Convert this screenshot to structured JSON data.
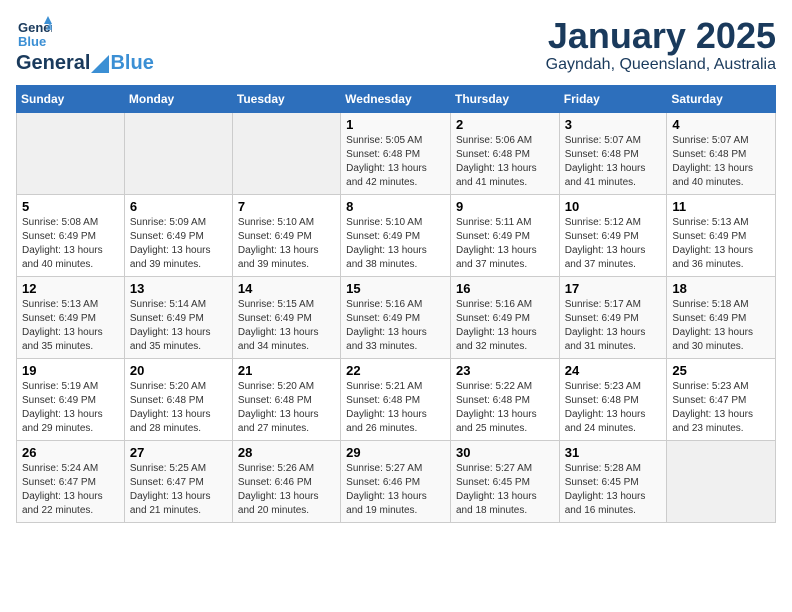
{
  "header": {
    "logo_general": "General",
    "logo_blue": "Blue",
    "title": "January 2025",
    "subtitle": "Gayndah, Queensland, Australia"
  },
  "weekdays": [
    "Sunday",
    "Monday",
    "Tuesday",
    "Wednesday",
    "Thursday",
    "Friday",
    "Saturday"
  ],
  "weeks": [
    [
      {
        "day": "",
        "info": ""
      },
      {
        "day": "",
        "info": ""
      },
      {
        "day": "",
        "info": ""
      },
      {
        "day": "1",
        "info": "Sunrise: 5:05 AM\nSunset: 6:48 PM\nDaylight: 13 hours\nand 42 minutes."
      },
      {
        "day": "2",
        "info": "Sunrise: 5:06 AM\nSunset: 6:48 PM\nDaylight: 13 hours\nand 41 minutes."
      },
      {
        "day": "3",
        "info": "Sunrise: 5:07 AM\nSunset: 6:48 PM\nDaylight: 13 hours\nand 41 minutes."
      },
      {
        "day": "4",
        "info": "Sunrise: 5:07 AM\nSunset: 6:48 PM\nDaylight: 13 hours\nand 40 minutes."
      }
    ],
    [
      {
        "day": "5",
        "info": "Sunrise: 5:08 AM\nSunset: 6:49 PM\nDaylight: 13 hours\nand 40 minutes."
      },
      {
        "day": "6",
        "info": "Sunrise: 5:09 AM\nSunset: 6:49 PM\nDaylight: 13 hours\nand 39 minutes."
      },
      {
        "day": "7",
        "info": "Sunrise: 5:10 AM\nSunset: 6:49 PM\nDaylight: 13 hours\nand 39 minutes."
      },
      {
        "day": "8",
        "info": "Sunrise: 5:10 AM\nSunset: 6:49 PM\nDaylight: 13 hours\nand 38 minutes."
      },
      {
        "day": "9",
        "info": "Sunrise: 5:11 AM\nSunset: 6:49 PM\nDaylight: 13 hours\nand 37 minutes."
      },
      {
        "day": "10",
        "info": "Sunrise: 5:12 AM\nSunset: 6:49 PM\nDaylight: 13 hours\nand 37 minutes."
      },
      {
        "day": "11",
        "info": "Sunrise: 5:13 AM\nSunset: 6:49 PM\nDaylight: 13 hours\nand 36 minutes."
      }
    ],
    [
      {
        "day": "12",
        "info": "Sunrise: 5:13 AM\nSunset: 6:49 PM\nDaylight: 13 hours\nand 35 minutes."
      },
      {
        "day": "13",
        "info": "Sunrise: 5:14 AM\nSunset: 6:49 PM\nDaylight: 13 hours\nand 35 minutes."
      },
      {
        "day": "14",
        "info": "Sunrise: 5:15 AM\nSunset: 6:49 PM\nDaylight: 13 hours\nand 34 minutes."
      },
      {
        "day": "15",
        "info": "Sunrise: 5:16 AM\nSunset: 6:49 PM\nDaylight: 13 hours\nand 33 minutes."
      },
      {
        "day": "16",
        "info": "Sunrise: 5:16 AM\nSunset: 6:49 PM\nDaylight: 13 hours\nand 32 minutes."
      },
      {
        "day": "17",
        "info": "Sunrise: 5:17 AM\nSunset: 6:49 PM\nDaylight: 13 hours\nand 31 minutes."
      },
      {
        "day": "18",
        "info": "Sunrise: 5:18 AM\nSunset: 6:49 PM\nDaylight: 13 hours\nand 30 minutes."
      }
    ],
    [
      {
        "day": "19",
        "info": "Sunrise: 5:19 AM\nSunset: 6:49 PM\nDaylight: 13 hours\nand 29 minutes."
      },
      {
        "day": "20",
        "info": "Sunrise: 5:20 AM\nSunset: 6:48 PM\nDaylight: 13 hours\nand 28 minutes."
      },
      {
        "day": "21",
        "info": "Sunrise: 5:20 AM\nSunset: 6:48 PM\nDaylight: 13 hours\nand 27 minutes."
      },
      {
        "day": "22",
        "info": "Sunrise: 5:21 AM\nSunset: 6:48 PM\nDaylight: 13 hours\nand 26 minutes."
      },
      {
        "day": "23",
        "info": "Sunrise: 5:22 AM\nSunset: 6:48 PM\nDaylight: 13 hours\nand 25 minutes."
      },
      {
        "day": "24",
        "info": "Sunrise: 5:23 AM\nSunset: 6:48 PM\nDaylight: 13 hours\nand 24 minutes."
      },
      {
        "day": "25",
        "info": "Sunrise: 5:23 AM\nSunset: 6:47 PM\nDaylight: 13 hours\nand 23 minutes."
      }
    ],
    [
      {
        "day": "26",
        "info": "Sunrise: 5:24 AM\nSunset: 6:47 PM\nDaylight: 13 hours\nand 22 minutes."
      },
      {
        "day": "27",
        "info": "Sunrise: 5:25 AM\nSunset: 6:47 PM\nDaylight: 13 hours\nand 21 minutes."
      },
      {
        "day": "28",
        "info": "Sunrise: 5:26 AM\nSunset: 6:46 PM\nDaylight: 13 hours\nand 20 minutes."
      },
      {
        "day": "29",
        "info": "Sunrise: 5:27 AM\nSunset: 6:46 PM\nDaylight: 13 hours\nand 19 minutes."
      },
      {
        "day": "30",
        "info": "Sunrise: 5:27 AM\nSunset: 6:45 PM\nDaylight: 13 hours\nand 18 minutes."
      },
      {
        "day": "31",
        "info": "Sunrise: 5:28 AM\nSunset: 6:45 PM\nDaylight: 13 hours\nand 16 minutes."
      },
      {
        "day": "",
        "info": ""
      }
    ]
  ]
}
